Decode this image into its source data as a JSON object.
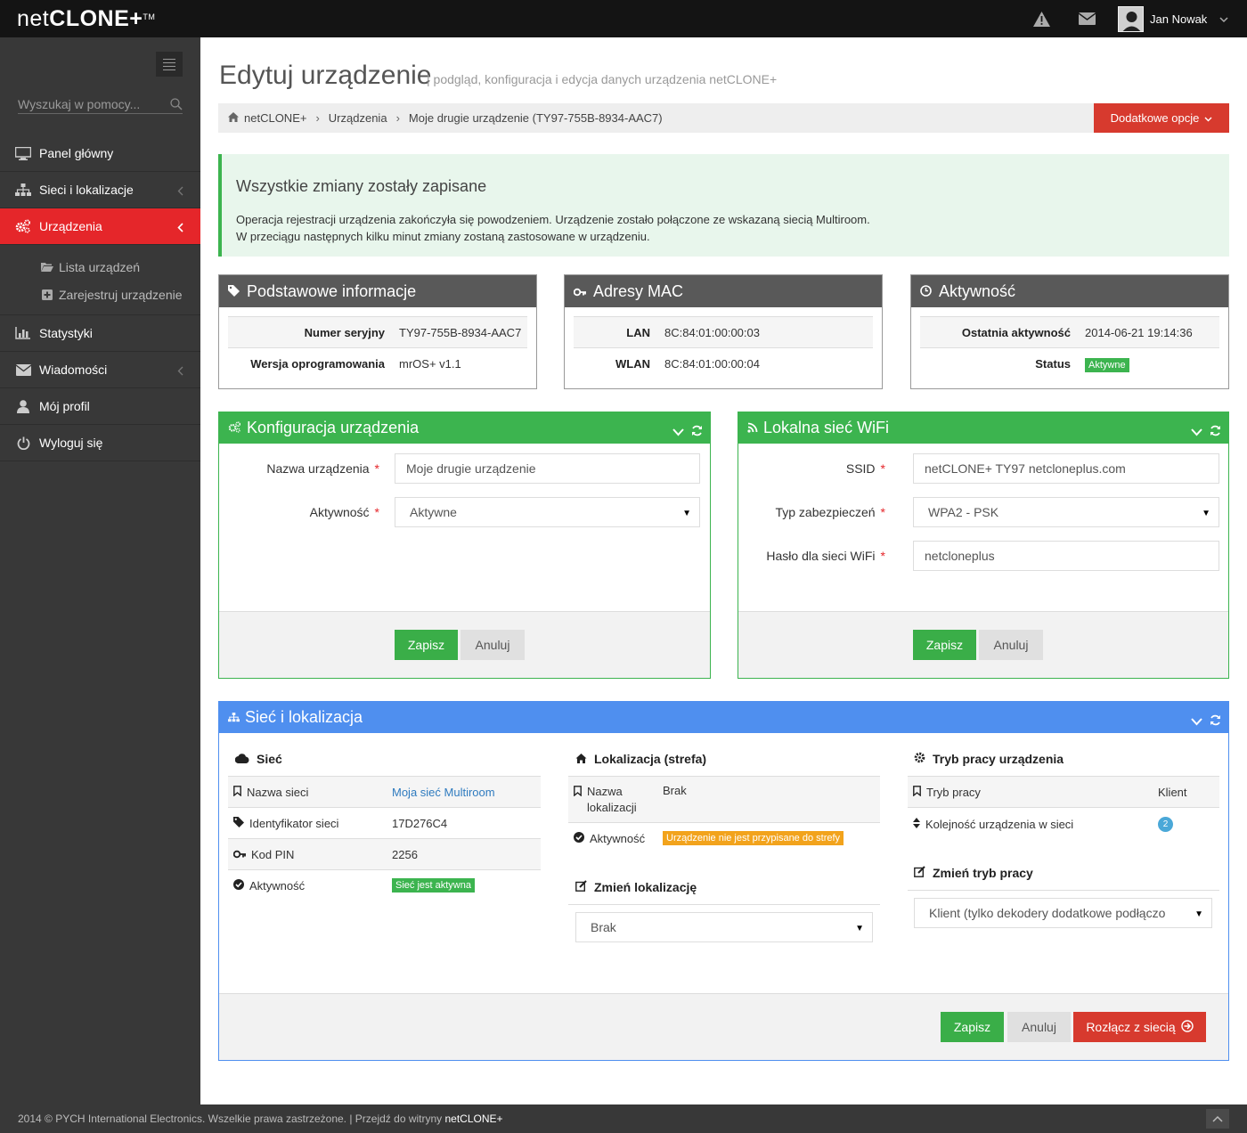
{
  "app": {
    "logo_light": "net",
    "logo_bold": "CLONE+",
    "logo_tm": "TM"
  },
  "topbar": {
    "alert_icon": "warning-icon",
    "mail_icon": "envelope-icon",
    "username": "Jan Nowak"
  },
  "sidebar": {
    "search_placeholder": "Wyszukaj w pomocy...",
    "items": [
      {
        "label": "Panel główny",
        "icon": "desktop-icon"
      },
      {
        "label": "Sieci i lokalizacje",
        "icon": "sitemap-icon"
      },
      {
        "label": "Urządzenia",
        "icon": "cogs-icon",
        "active": true
      },
      {
        "label": "Statystyki",
        "icon": "bar-chart-icon"
      },
      {
        "label": "Wiadomości",
        "icon": "envelope-icon"
      },
      {
        "label": "Mój profil",
        "icon": "user-icon"
      },
      {
        "label": "Wyloguj się",
        "icon": "power-icon"
      }
    ],
    "sub_items": [
      {
        "label": "Lista urządzeń",
        "icon": "folder-open-icon"
      },
      {
        "label": "Zarejestruj urządzenie",
        "icon": "plus-square-icon"
      }
    ]
  },
  "page": {
    "title": "Edytuj urządzenie",
    "subtitle": "| podgląd, konfiguracja i edycja danych urządzenia netCLONE+"
  },
  "breadcrumb": {
    "items": [
      "netCLONE+",
      "Urządzenia",
      "Moje drugie urządzenie (TY97-755B-8934-AAC7)"
    ],
    "options_label": "Dodatkowe opcje"
  },
  "alert": {
    "title": "Wszystkie zmiany zostały zapisane",
    "line1": "Operacja rejestracji urządzenia zakończyła się powodzeniem. Urządzenie zostało połączone ze wskazaną siecią Multiroom.",
    "line2": "W przeciągu następnych kilku minut zmiany zostaną zastosowane w urządzeniu."
  },
  "basic_info": {
    "title": "Podstawowe informacje",
    "rows": [
      {
        "key": "Numer seryjny",
        "value": "TY97-755B-8934-AAC7"
      },
      {
        "key": "Wersja oprogramowania",
        "value": "mrOS+ v1.1"
      }
    ]
  },
  "mac": {
    "title": "Adresy MAC",
    "rows": [
      {
        "key": "LAN",
        "value": "8C:84:01:00:00:03"
      },
      {
        "key": "WLAN",
        "value": "8C:84:01:00:00:04"
      }
    ]
  },
  "activity": {
    "title": "Aktywność",
    "rows": [
      {
        "key": "Ostatnia aktywność",
        "value": "2014-06-21 19:14:36"
      },
      {
        "key": "Status",
        "value": "Aktywne"
      }
    ]
  },
  "config": {
    "title": "Konfiguracja urządzenia",
    "name_label": "Nazwa urządzenia",
    "name_value": "Moje drugie urządzenie",
    "activity_label": "Aktywność",
    "activity_value": "Aktywne",
    "save": "Zapisz",
    "cancel": "Anuluj"
  },
  "wifi": {
    "title": "Lokalna sieć WiFi",
    "ssid_label": "SSID",
    "ssid_value": "netCLONE+ TY97 netcloneplus.com",
    "security_label": "Typ zabezpieczeń",
    "security_value": "WPA2 - PSK",
    "password_label": "Hasło dla sieci WiFi",
    "password_value": "netcloneplus",
    "save": "Zapisz",
    "cancel": "Anuluj"
  },
  "network": {
    "title": "Sieć i lokalizacja",
    "net": {
      "title": "Sieć",
      "rows": [
        {
          "key": "Nazwa sieci",
          "value": "Moja sieć Multiroom"
        },
        {
          "key": "Identyfikator sieci",
          "value": "17D276C4"
        },
        {
          "key": "Kod PIN",
          "value": "2256"
        },
        {
          "key": "Aktywność",
          "value": "Sieć jest aktywna"
        }
      ]
    },
    "location": {
      "title": "Lokalizacja (strefa)",
      "name_key_1": "Nazwa",
      "name_key_2": "lokalizacji",
      "name_value": "Brak",
      "activity_key": "Aktywność",
      "activity_value": "Urządzenie nie jest przypisane do strefy",
      "change_title": "Zmień lokalizację",
      "select_value": "Brak"
    },
    "mode": {
      "title": "Tryb pracy urządzenia",
      "mode_key": "Tryb pracy",
      "mode_value": "Klient",
      "order_key": "Kolejność urządzenia w sieci",
      "order_value": "2",
      "change_title": "Zmień tryb pracy",
      "select_value": "Klient (tylko dekodery dodatkowe podłączo"
    },
    "save": "Zapisz",
    "cancel": "Anuluj",
    "disconnect": "Rozłącz z siecią"
  },
  "footer": {
    "copyright": "2014 © PYCH International Electronics. Wszelkie prawa zastrzeżone. | Przejdź do witryny",
    "brand": "netCLONE+"
  },
  "colors": {
    "accent_red": "#e5262a",
    "success_green": "#3cb44f",
    "info_blue": "#4f8fef",
    "dark_header": "#595959"
  }
}
